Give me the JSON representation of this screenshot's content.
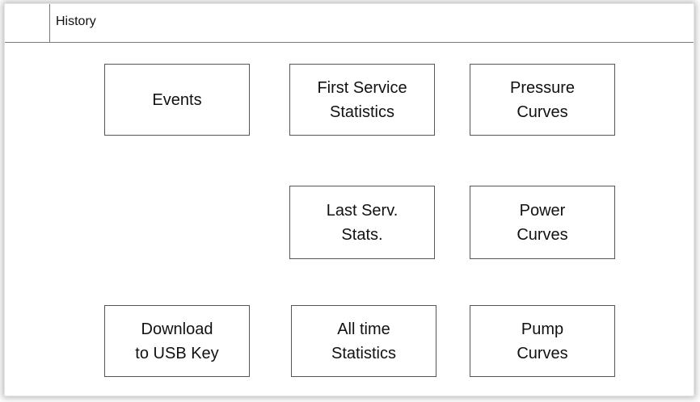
{
  "header": {
    "title": "History"
  },
  "tiles": {
    "events": "Events",
    "first_service_statistics": "First Service\nStatistics",
    "pressure_curves": "Pressure\nCurves",
    "last_serv_stats": "Last Serv.\nStats.",
    "power_curves": "Power\nCurves",
    "download_usb": "Download\nto USB Key",
    "all_time_statistics": "All time\nStatistics",
    "pump_curves": "Pump\nCurves"
  }
}
